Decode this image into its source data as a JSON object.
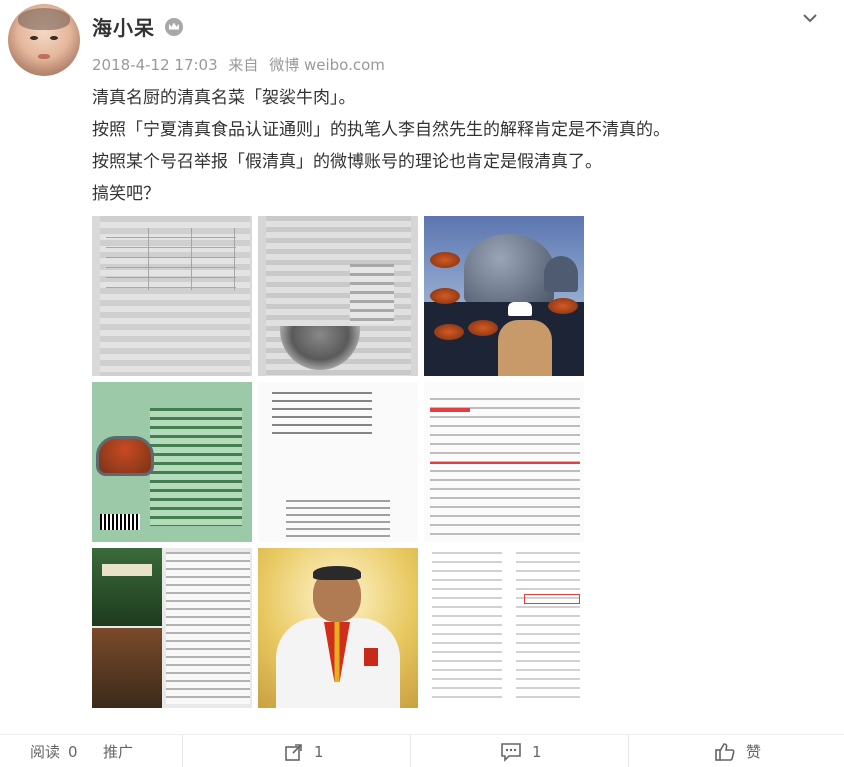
{
  "post": {
    "user_name": "海小呆",
    "timestamp": "2018-4-12 17:03",
    "source_prefix": "来自",
    "source_app": "微博 weibo.com",
    "lines": [
      "清真名厨的清真名菜「袈裟牛肉」。",
      "按照「宁夏清真食品认证通则」的执笔人李自然先生的解释肯定是不清真的。",
      "按照某个号召举报「假清真」的微博账号的理论也肯定是假清真了。",
      "搞笑吧？"
    ],
    "images_count": 9
  },
  "footer": {
    "read_label": "阅读",
    "read_count": "0",
    "promote_label": "推广",
    "repost_count": "1",
    "comment_count": "1",
    "like_label": "赞"
  },
  "icons": {
    "verified": "crown-icon",
    "menu": "chevron-down-icon",
    "repost": "share-icon",
    "comment": "comment-icon",
    "like": "thumbs-up-icon"
  },
  "colors": {
    "text": "#333333",
    "meta": "#999999",
    "footer_text": "#666666"
  }
}
